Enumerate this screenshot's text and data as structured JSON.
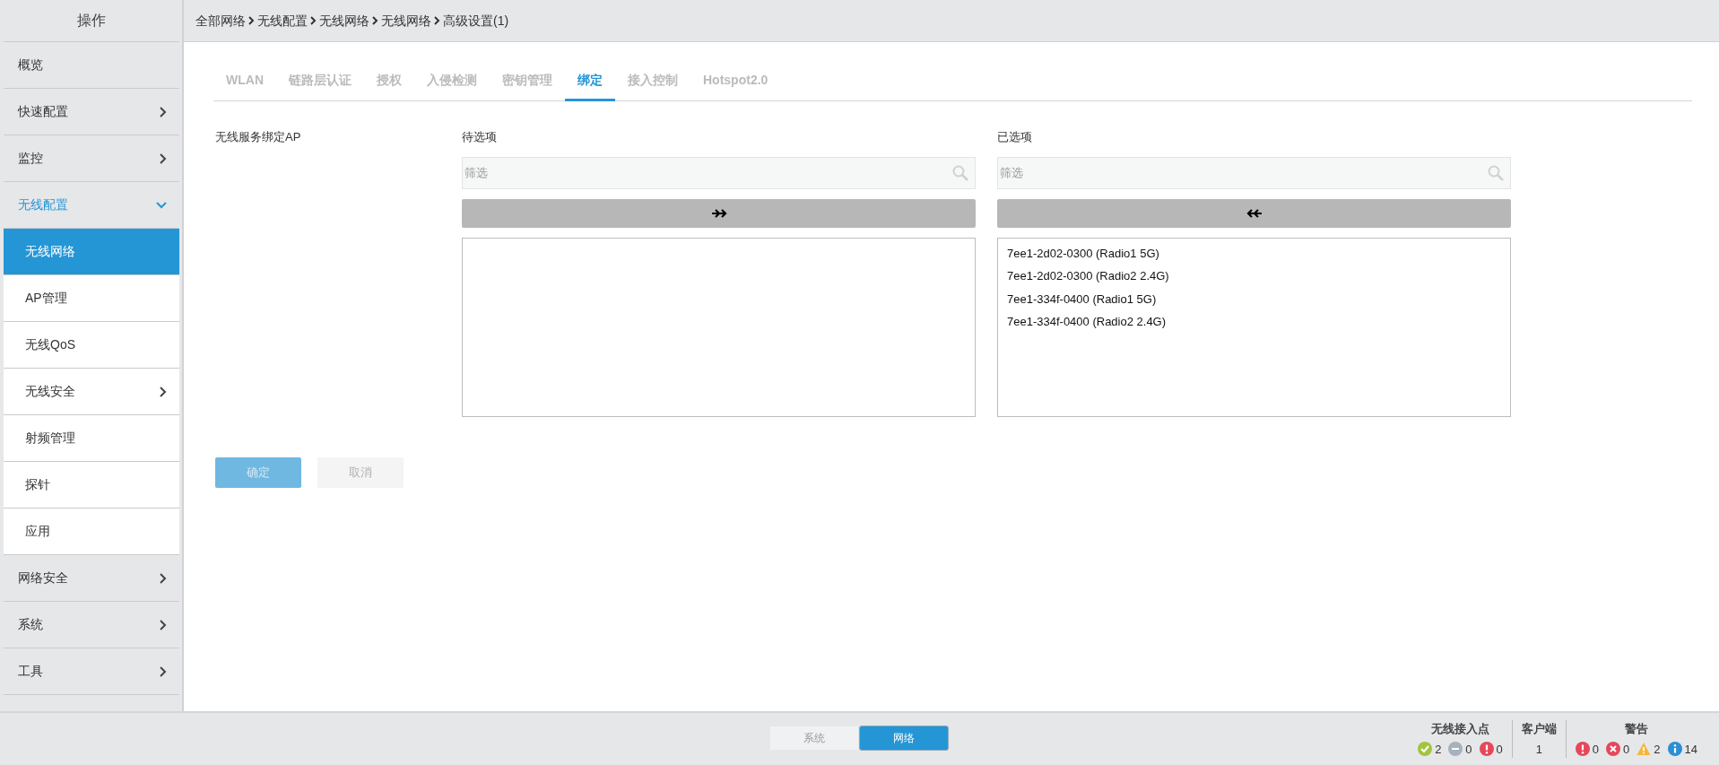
{
  "sidebar": {
    "title": "操作",
    "items": [
      {
        "label": "概览",
        "submenu": false,
        "selected": false
      },
      {
        "label": "快速配置",
        "submenu": true,
        "expanded": false,
        "selected": false
      },
      {
        "label": "监控",
        "submenu": true,
        "expanded": false,
        "selected": false
      },
      {
        "label": "无线配置",
        "submenu": true,
        "expanded": true,
        "selected": false,
        "children": [
          {
            "label": "无线网络",
            "submenu": false,
            "selected": true
          },
          {
            "label": "AP管理",
            "submenu": false,
            "selected": false
          },
          {
            "label": "无线QoS",
            "submenu": false,
            "selected": false
          },
          {
            "label": "无线安全",
            "submenu": true,
            "expanded": false,
            "selected": false
          },
          {
            "label": "射频管理",
            "submenu": false,
            "selected": false
          },
          {
            "label": "探针",
            "submenu": false,
            "selected": false
          },
          {
            "label": "应用",
            "submenu": false,
            "selected": false
          }
        ]
      },
      {
        "label": "网络安全",
        "submenu": true,
        "expanded": false,
        "selected": false
      },
      {
        "label": "系统",
        "submenu": true,
        "expanded": false,
        "selected": false
      },
      {
        "label": "工具",
        "submenu": true,
        "expanded": false,
        "selected": false
      }
    ]
  },
  "breadcrumb": [
    "全部网络",
    "无线配置",
    "无线网络",
    "无线网络",
    "高级设置(1)"
  ],
  "tabs": [
    {
      "label": "WLAN",
      "selected": false
    },
    {
      "label": "链路层认证",
      "selected": false
    },
    {
      "label": "授权",
      "selected": false
    },
    {
      "label": "入侵检测",
      "selected": false
    },
    {
      "label": "密钥管理",
      "selected": false
    },
    {
      "label": "绑定",
      "selected": true
    },
    {
      "label": "接入控制",
      "selected": false
    },
    {
      "label": "Hotspot2.0",
      "selected": false
    }
  ],
  "form": {
    "label": "无线服务绑定AP",
    "panels": [
      {
        "title": "待选项",
        "filter": {
          "placeholder": "筛选"
        },
        "kind": "add"
      },
      {
        "title": "已选项",
        "filter": {
          "placeholder": "筛选"
        },
        "kind": "remove",
        "items": [
          "7ee1-2d02-0300 (Radio1 5G)",
          "7ee1-2d02-0300 (Radio2 2.4G)",
          "7ee1-334f-0400 (Radio1 5G)",
          "7ee1-334f-0400 (Radio2 2.4G)"
        ]
      }
    ]
  },
  "buttons": [
    {
      "label": "确定",
      "kind": "primary",
      "disabled": true
    },
    {
      "label": "取消",
      "kind": "secondary",
      "disabled": true
    }
  ],
  "footer": {
    "view_toggle": [
      {
        "label": "系统",
        "selected": false
      },
      {
        "label": "网络",
        "selected": true
      }
    ],
    "status": [
      {
        "title": "无线接入点",
        "counters": [
          {
            "kind": "ok",
            "value": "2"
          },
          {
            "kind": "offline",
            "value": "0"
          },
          {
            "kind": "error",
            "value": "0"
          }
        ]
      },
      {
        "title": "客户端",
        "counters": [
          {
            "kind": "plain",
            "value": "1"
          }
        ]
      },
      {
        "title": "警告",
        "counters": [
          {
            "kind": "error",
            "value": "0"
          },
          {
            "kind": "critical",
            "value": "0"
          },
          {
            "kind": "warning",
            "value": "2"
          },
          {
            "kind": "info",
            "value": "14"
          }
        ]
      }
    ]
  }
}
